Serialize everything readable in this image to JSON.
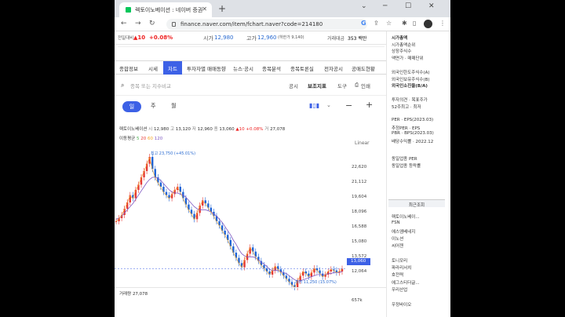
{
  "browser": {
    "tab_title": "렉토이노베이션 : 네이버 증권",
    "url": "finance.naver.com/item/fchart.naver?code=214180"
  },
  "header": {
    "prev_label": "전일대비",
    "prev_change": "▲10",
    "prev_pct": "+0.08%",
    "open_label": "시가",
    "open_value": "12,980",
    "high_label": "고가",
    "high_value": "12,960",
    "high_note": "(하한가 9,140)",
    "amount_label": "거래대금",
    "amount_value": "353 백만"
  },
  "subtabs": [
    "종합정보",
    "시세",
    "차트",
    "투자자별 매매동향",
    "뉴스·공시",
    "종목분석",
    "종목토론실",
    "전자공시",
    "공매도현황"
  ],
  "toolbar": {
    "search_placeholder": "종목 또는 지수비교",
    "gongsi": "공시",
    "indicator": "보조지표",
    "tools": "도구",
    "print": "인쇄"
  },
  "periods": [
    "일",
    "주",
    "월"
  ],
  "legend": {
    "name": "렉토이노베이션",
    "o_label": "시",
    "o": "12,980",
    "h_label": "고",
    "h": "13,120",
    "l_label": "저",
    "l": "12,960",
    "c_label": "종",
    "c": "13,060",
    "chg": "▲10",
    "pct": "+0.08%",
    "vol_label": "거",
    "vol": "27,078",
    "ma_label": "이동평균",
    "ma5": "5",
    "ma20": "20",
    "ma60": "60",
    "ma120": "120"
  },
  "chart": {
    "scale": "Linear",
    "high_annot": "최고 23,750 (+45.01%)",
    "low_annot": "최저 11,250 (15.07%)",
    "current_price": "13,060",
    "volume_label": "거래량",
    "volume_value": "27,078",
    "volume_axis": "657k"
  },
  "chart_data": {
    "type": "line",
    "ylim": [
      11000,
      24500
    ],
    "yticks": [
      "22,620",
      "21,112",
      "19,604",
      "18,096",
      "16,588",
      "15,080",
      "13,572",
      "12,064"
    ],
    "close_series": [
      17600,
      17900,
      18200,
      18800,
      19400,
      20100,
      19800,
      20600,
      21100,
      21800,
      22400,
      23100,
      23750,
      22600,
      21800,
      21300,
      20900,
      20400,
      20100,
      19800,
      20200,
      20600,
      20900,
      20400,
      19800,
      19200,
      18700,
      18300,
      17800,
      18400,
      19100,
      19600,
      19300,
      18900,
      18500,
      18100,
      17600,
      17200,
      16700,
      16300,
      15800,
      15200,
      14600,
      14100,
      13600,
      13200,
      13900,
      14500,
      15100,
      14700,
      14200,
      13800,
      13400,
      13100,
      12800,
      12500,
      12900,
      13300,
      13000,
      12700,
      12400,
      12100,
      11800,
      11500,
      11250,
      11900,
      12400,
      12800,
      12600,
      12300,
      12700,
      13100,
      12900,
      12600,
      12300,
      12500,
      12800,
      13000,
      12900,
      12700,
      12800,
      13060
    ],
    "ma_series": [
      17800,
      17900,
      18100,
      18400,
      18700,
      19000,
      19300,
      19700,
      20100,
      20500,
      20900,
      21300,
      21600,
      21800,
      21800,
      21700,
      21500,
      21200,
      20900,
      20600,
      20400,
      20300,
      20300,
      20200,
      20100,
      19900,
      19600,
      19300,
      19000,
      18800,
      18700,
      18700,
      18700,
      18600,
      18500,
      18300,
      18100,
      17800,
      17500,
      17100,
      16700,
      16300,
      15800,
      15400,
      14900,
      14500,
      14300,
      14200,
      14200,
      14200,
      14100,
      13900,
      13700,
      13500,
      13300,
      13000,
      12900,
      12900,
      12900,
      12800,
      12700,
      12600,
      12400,
      12200,
      12000,
      11900,
      11900,
      12000,
      12100,
      12200,
      12300,
      12400,
      12500,
      12500,
      12500,
      12500,
      12600,
      12600,
      12700,
      12700,
      12700,
      12800
    ]
  },
  "right_panel": {
    "lines1": [
      "시가총액",
      "시가총액순위",
      "상장주식수",
      "액면가 · 매매단위"
    ],
    "lines2": [
      "외국인한도주식수(A)",
      "외국인보유주식수(B)",
      "외국인소진율(B/A)"
    ],
    "lines3": [
      "투자의견 · 목표주가",
      "52주최고 · 최저"
    ],
    "lines4": [
      "PER · EPS(2023.03)",
      "추정PER · EPS",
      "PBR · BPS(2023.03)",
      "배당수익률 · 2022.12"
    ],
    "lines5": [
      "동일업종 PER",
      "동일업종 등락률"
    ],
    "recent_head": "최근조회",
    "recent": [
      "렉토이노베이...",
      "FSN",
      "에스엠베네지",
      "이노션",
      "씨어젠",
      "",
      "토니모리",
      "파라리서치",
      "호전력",
      "에그스티더글...",
      "우리산업",
      "",
      "우정바이오"
    ]
  }
}
